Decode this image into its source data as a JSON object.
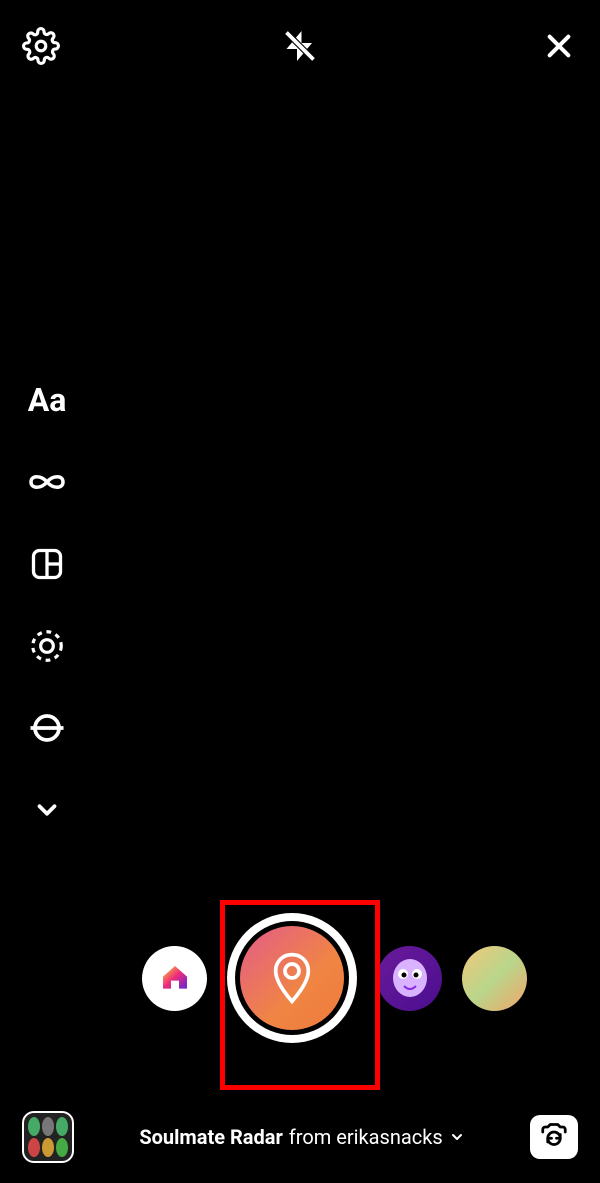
{
  "top": {
    "settings": "settings",
    "flash": "flash-off",
    "close": "close"
  },
  "tools": {
    "text": "Aa",
    "boomerang": "boomerang",
    "layout": "layout",
    "multicapture": "multicapture",
    "level": "level",
    "more": "more"
  },
  "filters": {
    "home": "home",
    "shutter_icon": "location-pin",
    "face": "face",
    "glow": "glow"
  },
  "effect": {
    "name": "Soulmate Radar",
    "by_prefix": "from ",
    "author": "erikasnacks"
  },
  "bottom": {
    "gallery": "gallery",
    "switch": "switch-camera"
  }
}
